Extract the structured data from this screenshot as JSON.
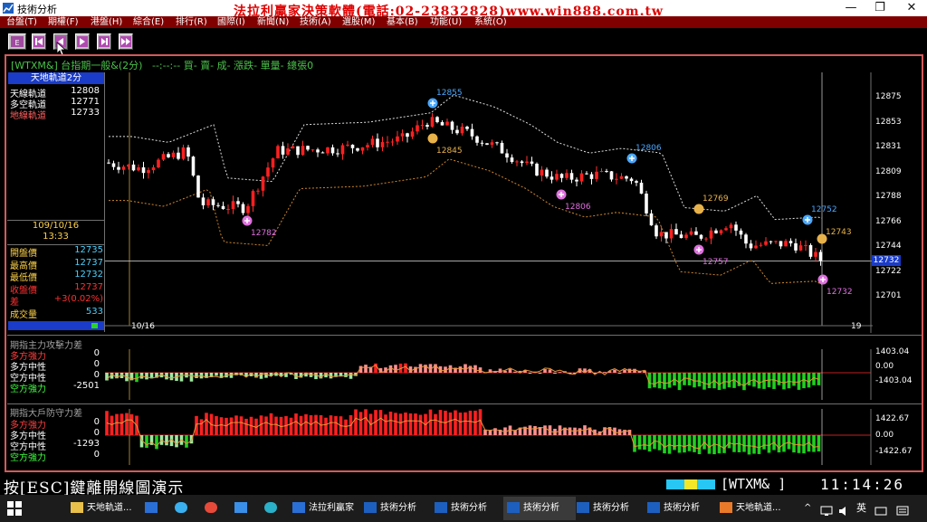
{
  "window": {
    "title": "技術分析",
    "ad_banner": "法拉利贏家決策軟體(電話:02-23832828)www.win888.com.tw",
    "minimize": "—",
    "maximize": "❐",
    "close": "✕"
  },
  "menu": [
    "台盤(T)",
    "期權(F)",
    "港盤(H)",
    "綜合(E)",
    "排行(R)",
    "國際(I)",
    "新聞(N)",
    "技術(A)",
    "選股(M)",
    "基本(B)",
    "功能(U)",
    "系統(O)"
  ],
  "toolbar": {
    "buttons": [
      "esc-button",
      "first-button",
      "prev-button",
      "play-button",
      "next-button",
      "last-button"
    ]
  },
  "chart_header": {
    "symbol": "[WTXM&]",
    "name": "台指期一般&(2分)",
    "time": "--:--:--",
    "fields": [
      "買-",
      "賣-",
      "成-",
      "漲跌-",
      "單量-",
      "總張0"
    ]
  },
  "left_panel": {
    "title": "天地軌道2分",
    "tracks": [
      {
        "label": "天線軌道",
        "value": "12808",
        "color": "#ffffff"
      },
      {
        "label": "多空軌道",
        "value": "12771",
        "color": "#ffffff"
      },
      {
        "label": "地線軌道",
        "value": "12733",
        "color": "#ff6060"
      }
    ],
    "date": "109/10/16",
    "time": "13:33",
    "quotes": [
      {
        "label": "開盤價",
        "value": "12735",
        "color": "#ffd24a",
        "vcolor": "#4ad2ff"
      },
      {
        "label": "最高價",
        "value": "12737",
        "color": "#ffd24a",
        "vcolor": "#4ad2ff"
      },
      {
        "label": "最低價",
        "value": "12732",
        "color": "#ffd24a",
        "vcolor": "#4ad2ff"
      },
      {
        "label": "收盤價",
        "value": "12737",
        "color": "#ff3030",
        "vcolor": "#ff3030"
      },
      {
        "label": "差",
        "value": "+3(0.02%)",
        "color": "#ff3030",
        "vcolor": "#ff3030"
      },
      {
        "label": "成交量",
        "value": "533",
        "color": "#ffd24a",
        "vcolor": "#4ad2ff"
      }
    ]
  },
  "main_chart": {
    "x_labels": [
      "10/16",
      "19"
    ],
    "y_ticks": [
      "12875",
      "12853",
      "12831",
      "12809",
      "12788",
      "12766",
      "12744",
      "12722",
      "12701"
    ],
    "current_price": "12732",
    "markers": [
      {
        "label": "12855",
        "kind": "high",
        "color": "#4aa8ff"
      },
      {
        "label": "12845",
        "kind": "mid",
        "color": "#e8b24a"
      },
      {
        "label": "12782",
        "kind": "low",
        "color": "#e070e0"
      },
      {
        "label": "12806",
        "kind": "high",
        "color": "#4aa8ff"
      },
      {
        "label": "12806",
        "kind": "low",
        "color": "#e070e0"
      },
      {
        "label": "12769",
        "kind": "mid",
        "color": "#e8b24a"
      },
      {
        "label": "12757",
        "kind": "low",
        "color": "#e070e0"
      },
      {
        "label": "12752",
        "kind": "high",
        "color": "#4aa8ff"
      },
      {
        "label": "12743",
        "kind": "mid",
        "color": "#e8b24a"
      },
      {
        "label": "12732",
        "kind": "low",
        "color": "#e070e0"
      }
    ]
  },
  "sub1": {
    "title": "期指主力攻擊力差",
    "rows": [
      {
        "label": "多方強力",
        "value": "0",
        "color": "#ff4040"
      },
      {
        "label": "多方中性",
        "value": "0",
        "color": "#ffffff"
      },
      {
        "label": "空方中性",
        "value": "0",
        "color": "#ffffff"
      },
      {
        "label": "空方強力",
        "value": "-2501",
        "color": "#40ff40"
      }
    ],
    "y_ticks": [
      "1403.04",
      "0.00",
      "-1403.04"
    ]
  },
  "sub2": {
    "title": "期指大戶防守力差",
    "rows": [
      {
        "label": "多方強力",
        "value": "0",
        "color": "#ff4040"
      },
      {
        "label": "多方中性",
        "value": "0",
        "color": "#ffffff"
      },
      {
        "label": "空方中性",
        "value": "-1293",
        "color": "#ffffff"
      },
      {
        "label": "空方強力",
        "value": "0",
        "color": "#40ff40"
      }
    ],
    "y_ticks": [
      "1422.67",
      "0.00",
      "-1422.67"
    ]
  },
  "status": {
    "hint": "按[ESC]鍵離開線圖演示",
    "symbol": "[WTXM&  ]",
    "clock": "11:14:26"
  },
  "taskbar": {
    "items": [
      {
        "label": "天地軌道...",
        "active": false
      },
      {
        "label": "",
        "active": false
      },
      {
        "label": "",
        "active": false
      },
      {
        "label": "",
        "active": false
      },
      {
        "label": "",
        "active": false
      },
      {
        "label": "",
        "active": false
      },
      {
        "label": "法拉利贏家",
        "active": false
      },
      {
        "label": "技術分析",
        "active": false
      },
      {
        "label": "技術分析",
        "active": false
      },
      {
        "label": "技術分析",
        "active": true
      },
      {
        "label": "技術分析",
        "active": false
      },
      {
        "label": "技術分析",
        "active": false
      },
      {
        "label": "天地軌道...",
        "active": false
      }
    ],
    "tray": {
      "ime": "英",
      "chevron": "^"
    }
  }
}
